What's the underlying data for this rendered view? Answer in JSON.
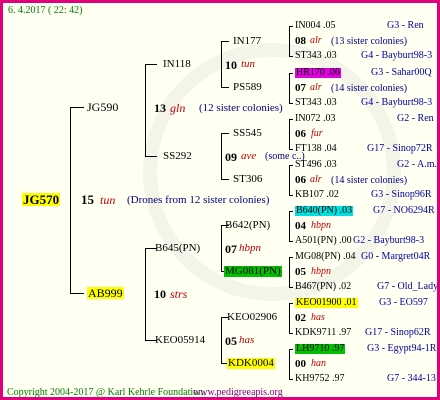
{
  "header": {
    "date": "6.  4.2017 ( 22: 42)"
  },
  "footer": {
    "copyright": "Copyright 2004-2017 @ Karl Kehrle Foundation.",
    "site": "www.pedigreeapis.org"
  },
  "colors": {
    "border": "#e0007a",
    "yellow": "#ffff00",
    "magenta": "#e000e0",
    "cyan": "#00e0e0",
    "green": "#00c000"
  },
  "root": {
    "id": "JG570",
    "gen": "15",
    "code": "tun",
    "note": "(Drones from 12 sister colonies)"
  },
  "p1": {
    "id": "JG590",
    "gen": "13",
    "code": "gln",
    "note": "(12 sister colonies)"
  },
  "p2": {
    "id": "AB999",
    "gen": "10",
    "code": "strs"
  },
  "g3": [
    {
      "id": "IN118",
      "gen": "10",
      "code": "tun"
    },
    {
      "id": "SS292",
      "gen": "09",
      "code": "ave",
      "note": "(some c..)"
    },
    {
      "id": "B645(PN)",
      "gen": "07",
      "code": "hbpn"
    },
    {
      "id": "KEO05914",
      "gen": "05",
      "code": "has"
    }
  ],
  "g4": [
    {
      "id": "IN177"
    },
    {
      "id": "PS589"
    },
    {
      "id": "SS545"
    },
    {
      "id": "ST306"
    },
    {
      "id": "B642(PN)"
    },
    {
      "id": "MG081(PN)"
    },
    {
      "id": "KEO02906"
    },
    {
      "id": "KDK0004"
    }
  ],
  "g4gen": [
    {
      "gen": "06",
      "code": "fur"
    },
    {
      "gen": "04",
      "code": "hbpn"
    },
    {
      "gen": "02",
      "code": "has"
    }
  ],
  "g5": [
    {
      "name": "IN004 .05",
      "loc": "G3 - Ren"
    },
    {
      "gen": "08",
      "code": "alr",
      "note": "(13 sister colonies)"
    },
    {
      "name": "ST343 .03",
      "loc": "G4 - Bayburt98-3"
    },
    {
      "name": "HR170 .06",
      "loc": "G3 - Sahar00Q"
    },
    {
      "gen": "07",
      "code": "alr",
      "note": "(14 sister colonies)"
    },
    {
      "name": "ST343 .03",
      "loc": "G4 - Bayburt98-3"
    },
    {
      "name": "IN072 .03",
      "loc": "G2 - Ren"
    },
    {
      "name": "FT138 .04",
      "loc": "G17 - Sinop72R"
    },
    {
      "name": "ST496 .03",
      "loc": "G2 - A.m."
    },
    {
      "gen": "06",
      "code": "alr",
      "note": "(14 sister colonies)"
    },
    {
      "name": "KB107 .02",
      "loc": "G3 - Sinop96R"
    },
    {
      "name": "B640(PN) .03",
      "loc": "G7 - NO6294R"
    },
    {
      "name": "A501(PN) .00",
      "loc": "G2 - Bayburt98-3"
    },
    {
      "name": "MG08(PN) .04",
      "loc": "G0 - Margret04R"
    },
    {
      "gen": "05",
      "code": "hbpn"
    },
    {
      "name": "B467(PN) .02",
      "loc": "G7 - Old_Lady"
    },
    {
      "name": "KEO01900 .01",
      "loc": "G3 - EO597"
    },
    {
      "name": "KDK9711 .97",
      "loc": "G17 - Sinop62R"
    },
    {
      "name": "LH9710 .97",
      "loc": "G3 - Egypt94-1R"
    },
    {
      "gen": "00",
      "code": "han"
    },
    {
      "name": "KH9752 .97",
      "loc": "G7 - 344-13"
    }
  ]
}
